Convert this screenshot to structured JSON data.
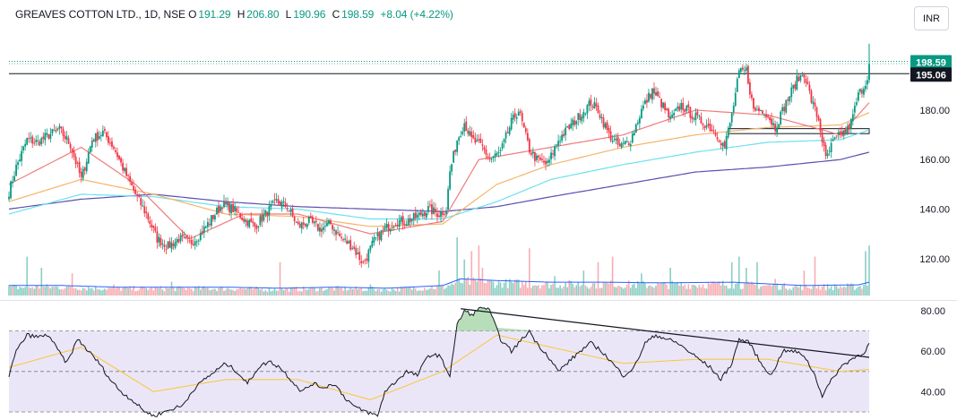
{
  "header": {
    "symbol": "GREAVES COTTON LTD., 1D, NSE",
    "o_label": "O",
    "o_value": "191.29",
    "h_label": "H",
    "h_value": "206.80",
    "l_label": "L",
    "l_value": "190.96",
    "c_label": "C",
    "c_value": "198.59",
    "change": "+8.04 (+4.22%)"
  },
  "currency_button": "INR",
  "colors": {
    "up": "#089981",
    "down": "#f23645",
    "ma_fast": "#f17b7b",
    "ma_mid": "#f5b46e",
    "ma_slow": "#6ee0ee",
    "ma_long": "#5b4fb0",
    "rsi_line": "#131722",
    "rsi_ma": "#f7c948",
    "rsi_band": "#ebe6f7",
    "last_price_badge": "#089981",
    "line_price_badge": "#131722"
  },
  "price_axis": {
    "ticks": [
      "180.00",
      "160.00",
      "140.00",
      "120.00"
    ],
    "last_price_label": "198.59",
    "horizontal_line_label": "195.06"
  },
  "rsi_axis": {
    "ticks": [
      "80.00",
      "60.00",
      "40.00"
    ]
  },
  "chart_data": {
    "type": "candlestick",
    "price_range": [
      104,
      210
    ],
    "last_price": 198.59,
    "horizontal_line": 195.06,
    "support_zone": [
      170.5,
      172.5
    ],
    "price_anchors": [
      [
        0,
        147
      ],
      [
        4,
        157
      ],
      [
        10,
        168
      ],
      [
        16,
        167
      ],
      [
        22,
        170
      ],
      [
        28,
        172
      ],
      [
        34,
        166
      ],
      [
        40,
        152
      ],
      [
        46,
        168
      ],
      [
        52,
        171
      ],
      [
        58,
        165
      ],
      [
        64,
        155
      ],
      [
        70,
        146
      ],
      [
        76,
        138
      ],
      [
        82,
        128
      ],
      [
        88,
        125
      ],
      [
        94,
        128
      ],
      [
        100,
        126
      ],
      [
        106,
        130
      ],
      [
        112,
        136
      ],
      [
        118,
        142
      ],
      [
        124,
        140
      ],
      [
        130,
        136
      ],
      [
        136,
        133
      ],
      [
        142,
        138
      ],
      [
        148,
        143
      ],
      [
        154,
        141
      ],
      [
        160,
        133
      ],
      [
        166,
        135
      ],
      [
        172,
        132
      ],
      [
        178,
        134
      ],
      [
        184,
        128
      ],
      [
        190,
        125
      ],
      [
        196,
        118
      ],
      [
        202,
        127
      ],
      [
        208,
        132
      ],
      [
        214,
        135
      ],
      [
        220,
        135
      ],
      [
        226,
        137
      ],
      [
        232,
        140
      ],
      [
        238,
        138
      ],
      [
        242,
        140
      ],
      [
        244,
        155
      ],
      [
        248,
        168
      ],
      [
        252,
        175
      ],
      [
        256,
        168
      ],
      [
        262,
        165
      ],
      [
        266,
        160
      ],
      [
        272,
        163
      ],
      [
        278,
        175
      ],
      [
        282,
        180
      ],
      [
        288,
        164
      ],
      [
        292,
        160
      ],
      [
        298,
        158
      ],
      [
        304,
        168
      ],
      [
        310,
        173
      ],
      [
        316,
        178
      ],
      [
        322,
        183
      ],
      [
        326,
        180
      ],
      [
        332,
        170
      ],
      [
        338,
        165
      ],
      [
        344,
        168
      ],
      [
        350,
        180
      ],
      [
        356,
        188
      ],
      [
        360,
        184
      ],
      [
        366,
        176
      ],
      [
        372,
        182
      ],
      [
        378,
        178
      ],
      [
        384,
        175
      ],
      [
        388,
        173
      ],
      [
        392,
        170
      ],
      [
        396,
        165
      ],
      [
        400,
        178
      ],
      [
        404,
        195
      ],
      [
        408,
        196
      ],
      [
        412,
        180
      ],
      [
        418,
        180
      ],
      [
        424,
        173
      ],
      [
        430,
        183
      ],
      [
        436,
        192
      ],
      [
        440,
        195
      ],
      [
        444,
        184
      ],
      [
        448,
        176
      ],
      [
        452,
        160
      ],
      [
        456,
        167
      ],
      [
        460,
        170
      ],
      [
        464,
        172
      ],
      [
        466,
        175
      ],
      [
        470,
        186
      ],
      [
        474,
        191
      ],
      [
        476,
        197
      ]
    ],
    "ma_fast_anchors": [
      [
        0,
        150
      ],
      [
        40,
        165
      ],
      [
        70,
        150
      ],
      [
        100,
        128
      ],
      [
        130,
        138
      ],
      [
        160,
        138
      ],
      [
        200,
        130
      ],
      [
        240,
        135
      ],
      [
        260,
        160
      ],
      [
        300,
        165
      ],
      [
        340,
        170
      ],
      [
        380,
        180
      ],
      [
        420,
        178
      ],
      [
        460,
        170
      ],
      [
        476,
        183
      ]
    ],
    "ma_mid_anchors": [
      [
        0,
        143
      ],
      [
        40,
        152
      ],
      [
        80,
        146
      ],
      [
        120,
        138
      ],
      [
        160,
        137
      ],
      [
        200,
        133
      ],
      [
        240,
        134
      ],
      [
        270,
        150
      ],
      [
        300,
        158
      ],
      [
        340,
        165
      ],
      [
        380,
        170
      ],
      [
        420,
        173
      ],
      [
        460,
        174
      ],
      [
        476,
        179
      ]
    ],
    "ma_slow_anchors": [
      [
        0,
        138
      ],
      [
        40,
        146
      ],
      [
        80,
        145
      ],
      [
        120,
        141
      ],
      [
        160,
        140
      ],
      [
        200,
        136
      ],
      [
        240,
        136
      ],
      [
        270,
        143
      ],
      [
        300,
        152
      ],
      [
        340,
        158
      ],
      [
        380,
        163
      ],
      [
        420,
        167
      ],
      [
        460,
        168
      ],
      [
        476,
        172
      ]
    ],
    "ma_long_anchors": [
      [
        0,
        140
      ],
      [
        40,
        144
      ],
      [
        80,
        146
      ],
      [
        120,
        143
      ],
      [
        160,
        141
      ],
      [
        200,
        140
      ],
      [
        240,
        139
      ],
      [
        270,
        141
      ],
      [
        300,
        145
      ],
      [
        340,
        150
      ],
      [
        380,
        155
      ],
      [
        420,
        157
      ],
      [
        460,
        160
      ],
      [
        476,
        163
      ]
    ],
    "volume_anchors": [
      [
        0,
        3
      ],
      [
        30,
        3
      ],
      [
        60,
        2.5
      ],
      [
        90,
        2.5
      ],
      [
        120,
        2.5
      ],
      [
        150,
        2.2
      ],
      [
        180,
        2.5
      ],
      [
        210,
        2.2
      ],
      [
        240,
        3
      ],
      [
        250,
        5
      ],
      [
        270,
        4.5
      ],
      [
        300,
        4
      ],
      [
        330,
        4
      ],
      [
        360,
        3.8
      ],
      [
        400,
        4
      ],
      [
        440,
        3
      ],
      [
        470,
        3.2
      ],
      [
        476,
        4
      ]
    ],
    "volume_spikes": [
      [
        10,
        14
      ],
      [
        18,
        10
      ],
      [
        35,
        8
      ],
      [
        58,
        4
      ],
      [
        90,
        5
      ],
      [
        150,
        12
      ],
      [
        200,
        4
      ],
      [
        238,
        9
      ],
      [
        248,
        21
      ],
      [
        252,
        13
      ],
      [
        256,
        16
      ],
      [
        260,
        18
      ],
      [
        262,
        10
      ],
      [
        288,
        17
      ],
      [
        302,
        7
      ],
      [
        318,
        9
      ],
      [
        326,
        12
      ],
      [
        334,
        14
      ],
      [
        350,
        8
      ],
      [
        366,
        10
      ],
      [
        400,
        12
      ],
      [
        404,
        14
      ],
      [
        408,
        10
      ],
      [
        414,
        12
      ],
      [
        424,
        6
      ],
      [
        440,
        9
      ],
      [
        446,
        14
      ],
      [
        474,
        16
      ],
      [
        476,
        18
      ]
    ],
    "rsi_range": [
      26,
      84
    ],
    "rsi_levels": [
      70,
      50,
      30
    ],
    "rsi_anchors": [
      [
        0,
        48
      ],
      [
        4,
        60
      ],
      [
        10,
        68
      ],
      [
        16,
        67
      ],
      [
        22,
        68
      ],
      [
        26,
        62
      ],
      [
        32,
        54
      ],
      [
        38,
        66
      ],
      [
        44,
        60
      ],
      [
        50,
        54
      ],
      [
        56,
        46
      ],
      [
        62,
        40
      ],
      [
        68,
        36
      ],
      [
        74,
        31
      ],
      [
        80,
        28
      ],
      [
        86,
        30
      ],
      [
        92,
        32
      ],
      [
        96,
        33
      ],
      [
        102,
        41
      ],
      [
        108,
        46
      ],
      [
        114,
        50
      ],
      [
        120,
        54
      ],
      [
        126,
        50
      ],
      [
        132,
        44
      ],
      [
        138,
        52
      ],
      [
        144,
        55
      ],
      [
        150,
        52
      ],
      [
        156,
        46
      ],
      [
        162,
        40
      ],
      [
        168,
        44
      ],
      [
        174,
        42
      ],
      [
        180,
        44
      ],
      [
        186,
        37
      ],
      [
        192,
        32
      ],
      [
        198,
        30
      ],
      [
        204,
        28
      ],
      [
        208,
        40
      ],
      [
        214,
        45
      ],
      [
        220,
        50
      ],
      [
        226,
        48
      ],
      [
        232,
        58
      ],
      [
        238,
        58
      ],
      [
        244,
        48
      ],
      [
        248,
        73
      ],
      [
        252,
        80
      ],
      [
        256,
        78
      ],
      [
        262,
        82
      ],
      [
        266,
        80
      ],
      [
        272,
        66
      ],
      [
        278,
        60
      ],
      [
        284,
        66
      ],
      [
        288,
        70
      ],
      [
        292,
        64
      ],
      [
        298,
        58
      ],
      [
        304,
        50
      ],
      [
        310,
        55
      ],
      [
        316,
        60
      ],
      [
        322,
        64
      ],
      [
        328,
        60
      ],
      [
        334,
        54
      ],
      [
        340,
        48
      ],
      [
        346,
        52
      ],
      [
        352,
        64
      ],
      [
        358,
        68
      ],
      [
        364,
        66
      ],
      [
        370,
        64
      ],
      [
        376,
        60
      ],
      [
        382,
        56
      ],
      [
        388,
        52
      ],
      [
        394,
        46
      ],
      [
        400,
        54
      ],
      [
        404,
        66
      ],
      [
        410,
        64
      ],
      [
        416,
        54
      ],
      [
        422,
        48
      ],
      [
        428,
        60
      ],
      [
        434,
        60
      ],
      [
        440,
        58
      ],
      [
        446,
        48
      ],
      [
        450,
        38
      ],
      [
        454,
        44
      ],
      [
        460,
        52
      ],
      [
        466,
        56
      ],
      [
        470,
        58
      ],
      [
        474,
        60
      ],
      [
        476,
        64
      ]
    ],
    "rsi_ma_anchors": [
      [
        0,
        52
      ],
      [
        40,
        62
      ],
      [
        80,
        40
      ],
      [
        120,
        46
      ],
      [
        160,
        46
      ],
      [
        200,
        36
      ],
      [
        240,
        50
      ],
      [
        270,
        68
      ],
      [
        300,
        62
      ],
      [
        340,
        54
      ],
      [
        380,
        56
      ],
      [
        420,
        56
      ],
      [
        460,
        50
      ],
      [
        476,
        51
      ]
    ],
    "trendline_rsi": [
      [
        250,
        81
      ],
      [
        476,
        57
      ]
    ]
  }
}
